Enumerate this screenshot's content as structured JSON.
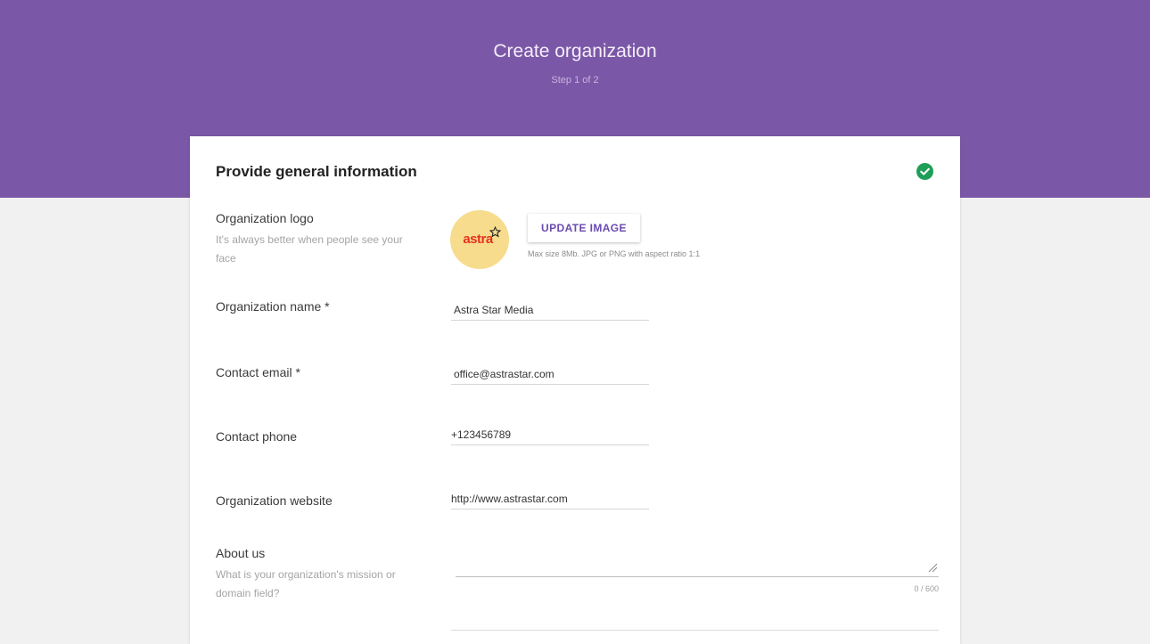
{
  "header": {
    "title": "Create organization",
    "step": "Step 1 of 2"
  },
  "card": {
    "title": "Provide general information",
    "status_icon": "check-circle-icon"
  },
  "logo": {
    "label": "Organization logo",
    "hint": "It's always better when people see your face",
    "avatar_text": "astra",
    "button_label": "UPDATE IMAGE",
    "requirements": "Max size 8Mb. JPG or PNG with aspect ratio 1:1"
  },
  "fields": {
    "name": {
      "label": "Organization name *",
      "value": "Astra Star Media"
    },
    "email": {
      "label": "Contact email *",
      "value": "office@astrastar.com"
    },
    "phone": {
      "label": "Contact phone",
      "value": "+123456789"
    },
    "website": {
      "label": "Organization website",
      "value": "http://www.astrastar.com"
    }
  },
  "about": {
    "label": "About us",
    "hint": "What is your organization's mission or domain field?",
    "value": "",
    "counter": "0 / 600"
  },
  "colors": {
    "header": "#7b57a7",
    "accent": "#6a4bb0",
    "success": "#1e9e57",
    "avatar_bg": "#f6dc8c",
    "avatar_text": "#e5331f"
  }
}
